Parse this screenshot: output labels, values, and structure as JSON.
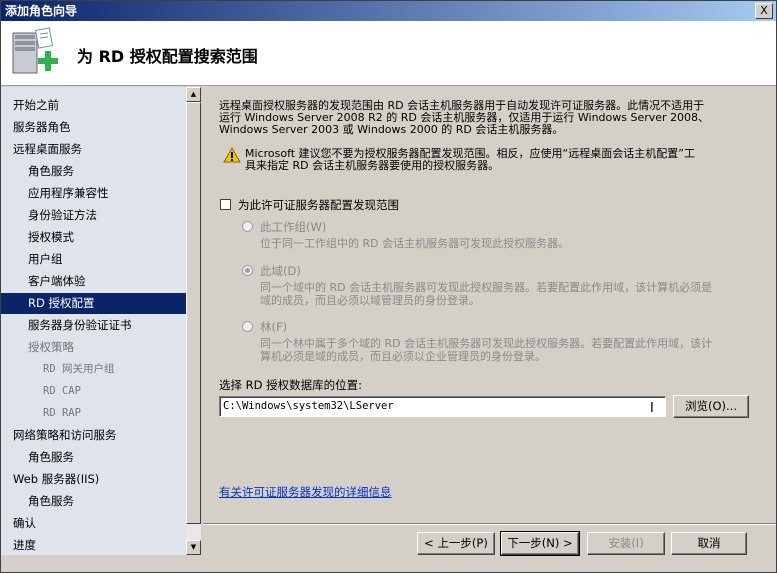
{
  "window": {
    "title": "添加角色向导",
    "close_glyph": "X"
  },
  "header": {
    "title": "为 RD 授权配置搜索范围",
    "icon": "server-add-icon"
  },
  "sidebar": {
    "items": [
      {
        "label": "开始之前",
        "level": 0,
        "state": "normal"
      },
      {
        "label": "服务器角色",
        "level": 0,
        "state": "normal"
      },
      {
        "label": "远程桌面服务",
        "level": 0,
        "state": "normal"
      },
      {
        "label": "角色服务",
        "level": 1,
        "state": "normal"
      },
      {
        "label": "应用程序兼容性",
        "level": 1,
        "state": "normal"
      },
      {
        "label": "身份验证方法",
        "level": 1,
        "state": "normal"
      },
      {
        "label": "授权模式",
        "level": 1,
        "state": "normal"
      },
      {
        "label": "用户组",
        "level": 1,
        "state": "normal"
      },
      {
        "label": "客户端体验",
        "level": 1,
        "state": "normal"
      },
      {
        "label": "RD 授权配置",
        "level": 1,
        "state": "selected"
      },
      {
        "label": "服务器身份验证证书",
        "level": 1,
        "state": "normal"
      },
      {
        "label": "授权策略",
        "level": 1,
        "state": "disabled"
      },
      {
        "label": "RD 网关用户组",
        "level": 2,
        "state": "disabled"
      },
      {
        "label": "RD CAP",
        "level": 2,
        "state": "disabled"
      },
      {
        "label": "RD RAP",
        "level": 2,
        "state": "disabled"
      },
      {
        "label": "网络策略和访问服务",
        "level": 0,
        "state": "normal"
      },
      {
        "label": "角色服务",
        "level": 1,
        "state": "normal"
      },
      {
        "label": "Web 服务器(IIS)",
        "level": 0,
        "state": "normal"
      },
      {
        "label": "角色服务",
        "level": 1,
        "state": "normal"
      },
      {
        "label": "确认",
        "level": 0,
        "state": "normal"
      },
      {
        "label": "进度",
        "level": 0,
        "state": "normal"
      }
    ]
  },
  "content": {
    "description_lines": [
      "远程桌面授权服务器的发现范围由 RD 会话主机服务器用于自动发现许可证服务器。此情况不适用于",
      "运行 Windows Server 2008 R2 的 RD 会话主机服务器，仅适用于运行 Windows Server 2008、",
      "Windows Server 2003 或 Windows 2000 的 RD 会话主机服务器。"
    ],
    "warning_lines": [
      "Microsoft 建议您不要为授权服务器配置发现范围。相反，应使用“远程桌面会话主机配置”工",
      "具来指定 RD 会话主机服务器要使用的授权服务器。"
    ],
    "checkbox_label": "为此许可证服务器配置发现范围",
    "options": [
      {
        "label": "此工作组(W)",
        "desc_lines": [
          "位于同一工作组中的 RD 会话主机服务器可发现此授权服务器。"
        ],
        "checked": false
      },
      {
        "label": "此域(D)",
        "desc_lines": [
          "同一个域中的 RD 会话主机服务器可发现此授权服务器。若要配置此作用域，该计算机必须是",
          "域的成员，而且必须以域管理员的身份登录。"
        ],
        "checked": true
      },
      {
        "label": "林(F)",
        "desc_lines": [
          "同一个林中属于多个域的 RD 会话主机服务器可发现此授权服务器。若要配置此作用域，该计",
          "算机必须是域的成员，而且必须以企业管理员的身份登录。"
        ],
        "checked": false
      }
    ],
    "db_location_label": "选择 RD 授权数据库的位置:",
    "db_path_value": "C:\\Windows\\system32\\LServer",
    "browse_label": "浏览(O)...",
    "more_info_link": "有关许可证服务器发现的详细信息"
  },
  "buttons": {
    "prev": "< 上一步(P)",
    "next": "下一步(N) >",
    "install": "安装(I)",
    "cancel": "取消"
  }
}
